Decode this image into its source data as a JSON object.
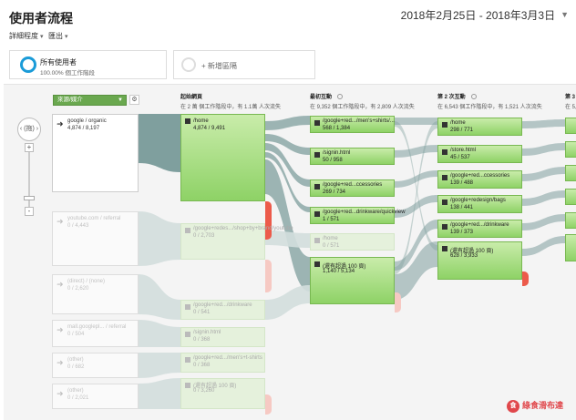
{
  "header": {
    "title": "使用者流程",
    "date_range": "2018年2月25日 - 2018年3月3日"
  },
  "toolbar": {
    "detail_label": "詳細程度",
    "export_label": "匯出"
  },
  "segments": [
    {
      "name": "所有使用者",
      "sub": "100.00% 個工作階段"
    },
    {
      "name": "+ 新增區隔"
    }
  ],
  "flow": {
    "dimension_selector": "來源/媒介",
    "nav_label": "(拖)",
    "columns": [
      {
        "title": "起始網頁",
        "sub": "在 2 萬 個工作階段中，有 1.1萬 人次流失"
      },
      {
        "title": "最初互動",
        "sub": "在 9,352 個工作階段中，有 2,809 人次流失"
      },
      {
        "title": "第 2 次互動",
        "sub": "在 6,543 個工作階段中，有 1,521 人次流失"
      },
      {
        "title": "第 3",
        "sub": "在 5,0"
      }
    ],
    "sources": [
      {
        "label": "google / organic",
        "value": "4,874 / 8,197"
      },
      {
        "label": "youtube.com / referral",
        "value": "0 / 4,443"
      },
      {
        "label": "(direct) / (none)",
        "value": "0 / 2,620"
      },
      {
        "label": "mall.googlepl... / referral",
        "value": "0 / 504"
      },
      {
        "label": "(other)",
        "value": "0 / 682"
      },
      {
        "label": "(other)",
        "value": "0 / 2,021"
      }
    ],
    "start_pages": [
      {
        "label": "/home",
        "value": "4,874 / 9,491"
      },
      {
        "label": "/google+redes.../shop+by+brand/youtube",
        "value": "0 / 2,703"
      },
      {
        "label": "/google+red.../drinkware",
        "value": "0 / 541"
      },
      {
        "label": "/signin.html",
        "value": "0 / 368"
      },
      {
        "label": "/google+red.../men's+t-shirts",
        "value": "0 / 368"
      },
      {
        "label": "(還有超過 100 頁)",
        "value": "0 / 3,260"
      }
    ],
    "first_interaction": [
      {
        "label": "/google+red.../men's+shirts/...",
        "value": "568 / 1,384"
      },
      {
        "label": "/signin.html",
        "value": "50 / 958"
      },
      {
        "label": "/google+red...ccessories",
        "value": "269 / 734"
      },
      {
        "label": "/google+red...drinkware/quickview",
        "value": "1 / 571"
      },
      {
        "label": "/home",
        "value": "0 / 571"
      },
      {
        "label": "(還有超過 100 頁)",
        "value": "1,140 / 5,134"
      }
    ],
    "second_interaction": [
      {
        "label": "/home",
        "value": "298 / 771"
      },
      {
        "label": "/store.html",
        "value": "45 / 537"
      },
      {
        "label": "/google+red...ccessories",
        "value": "139 / 488"
      },
      {
        "label": "/google+redesign/bags",
        "value": "138 / 441"
      },
      {
        "label": "/google+red.../drinkware",
        "value": "139 / 373"
      },
      {
        "label": "(還有超過 100 頁)",
        "value": "628 / 3,933"
      }
    ]
  },
  "watermark": {
    "badge": "食",
    "text": "綠食滑布達"
  },
  "colors": {
    "node_green": "#8ed266",
    "dropoff_red": "#ec5a4a",
    "accent_blue": "#1a9bd8",
    "selector_green": "#6aa84f"
  }
}
